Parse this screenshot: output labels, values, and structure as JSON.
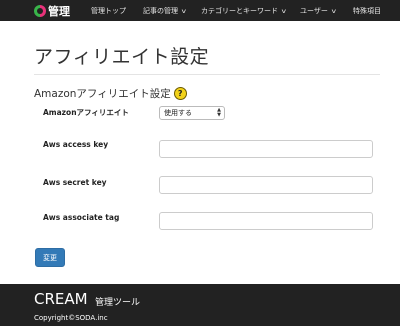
{
  "nav": {
    "brand": "管理",
    "items": [
      {
        "label": "管理トップ",
        "dropdown": false
      },
      {
        "label": "記事の管理",
        "dropdown": true
      },
      {
        "label": "カテゴリーとキーワード",
        "dropdown": true
      },
      {
        "label": "ユーザー",
        "dropdown": true
      },
      {
        "label": "特殊項目",
        "dropdown": true
      }
    ]
  },
  "page": {
    "title": "アフィリエイト設定",
    "section_title": "Amazonアフィリエイト設定",
    "help_icon": "?"
  },
  "form": {
    "amazon_affiliate": {
      "label": "Amazonアフィリエイト",
      "selected": "使用する"
    },
    "access_key": {
      "label": "Aws access key",
      "value": ""
    },
    "secret_key": {
      "label": "Aws secret key",
      "value": ""
    },
    "associate_tag": {
      "label": "Aws associate tag",
      "value": ""
    },
    "submit_label": "変更"
  },
  "footer": {
    "brand": "CREAM",
    "subtitle": "管理ツール",
    "copyright": "Copyright©SODA.inc"
  },
  "colors": {
    "navbar": "#222222",
    "primary_button": "#337ab7",
    "help_icon": "#f2d21a"
  }
}
